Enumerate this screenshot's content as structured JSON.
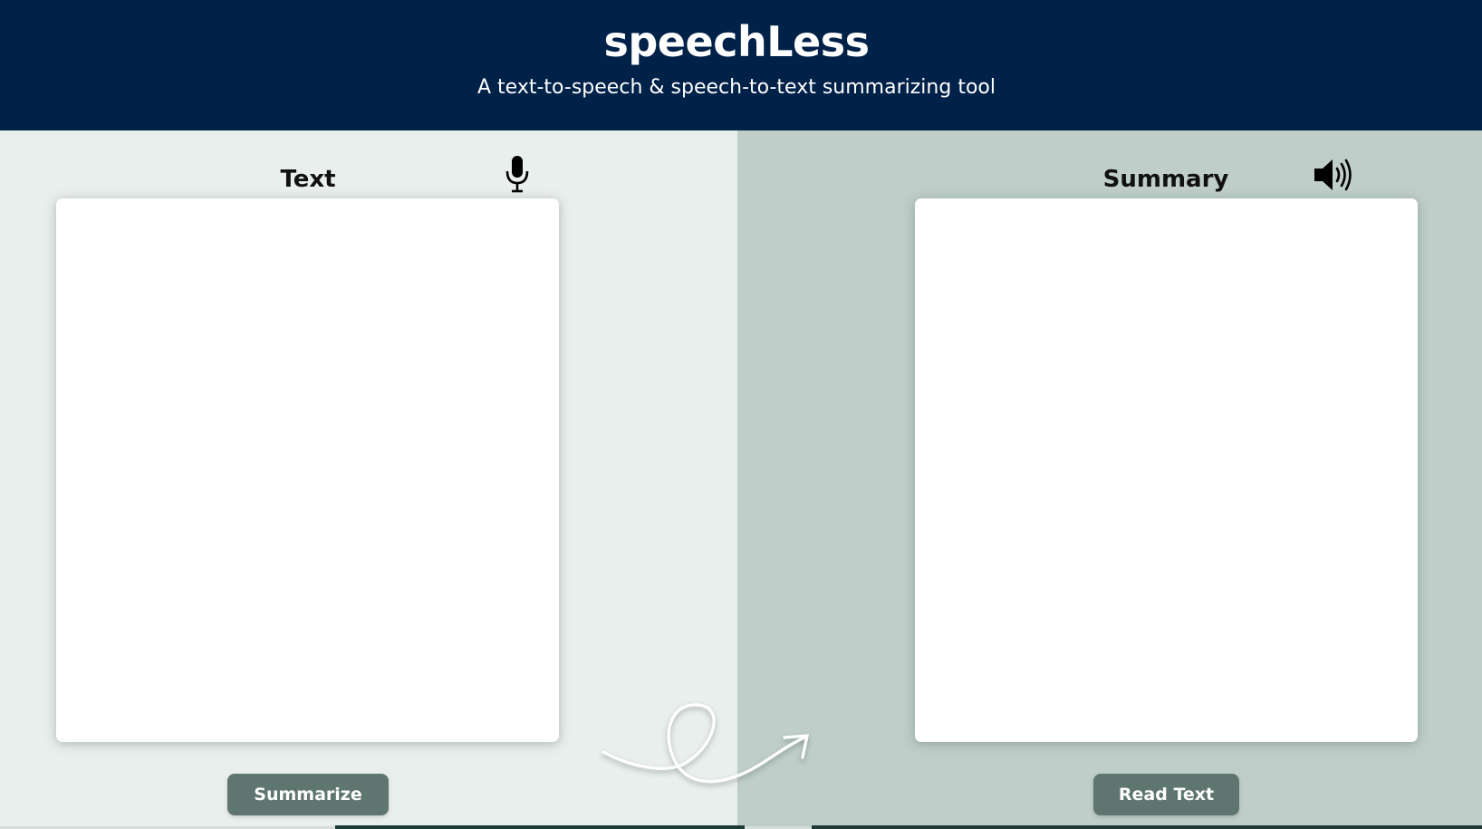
{
  "header": {
    "title": "speechLess",
    "subtitle": "A text-to-speech & speech-to-text summarizing tool"
  },
  "input_panel": {
    "heading": "Text",
    "icon": "microphone-icon",
    "textarea_value": "",
    "button_label": "Summarize"
  },
  "output_panel": {
    "heading": "Summary",
    "icon": "speaker-icon",
    "textarea_value": "",
    "button_label": "Read Text"
  },
  "colors": {
    "header_bg": "#002148",
    "left_panel_bg": "#e9efed",
    "right_panel_bg": "#bfcec8",
    "button_bg": "#5e766f"
  }
}
